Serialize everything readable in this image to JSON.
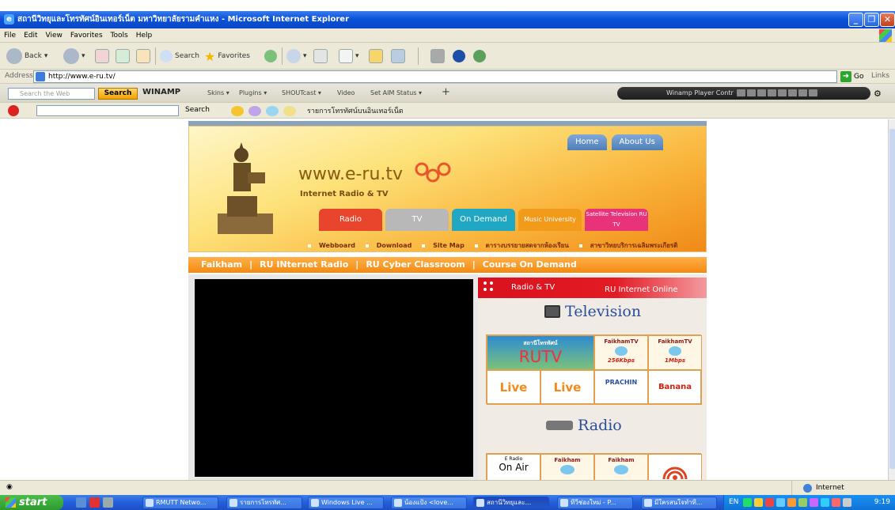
{
  "window": {
    "title": "สถานีวิทยุและโทรทัศน์อินเทอร์เน็ต มหาวิทยาลัยรามคำแหง - Microsoft Internet Explorer"
  },
  "menubar": {
    "items": [
      "File",
      "Edit",
      "View",
      "Favorites",
      "Tools",
      "Help"
    ]
  },
  "toolbar": {
    "back": "Back",
    "search": "Search",
    "favorites": "Favorites"
  },
  "address": {
    "label": "Address",
    "url": "http://www.e-ru.tv/",
    "go": "Go",
    "links": "Links"
  },
  "winamp_bar": {
    "search_placeholder": "Search the Web",
    "search_button": "Search",
    "brand": "WINAMP",
    "menus": [
      "Skins ▾",
      "Plugins ▾",
      "SHOUTcast ▾",
      "Video",
      "Set AIM Status ▾"
    ],
    "player_label": "Winamp Player Contr"
  },
  "toolbar3": {
    "search": "Search",
    "thai_link": "รายการโทรทัศน์บนอินเทอร์เน็ต"
  },
  "site": {
    "nav_top": [
      "Home",
      "About Us"
    ],
    "name": "www.e-ru.tv",
    "tagline": "Internet Radio & TV",
    "tabs": [
      {
        "label": "Radio",
        "color": "#e8452c"
      },
      {
        "label": "TV",
        "color": "#b8b8b8"
      },
      {
        "label": "On Demand",
        "color": "#1fa7c4"
      },
      {
        "label": "Music University",
        "color": "#f29a1a"
      },
      {
        "label": "Satellite Television RU TV",
        "color": "#e8337a"
      }
    ],
    "sub_links": [
      "Webboard",
      "Download",
      "Site Map",
      "ตารางบรรยายสดจากห้องเรียน",
      "สาขาวิทยบริการเฉลิมพระเกียรติ"
    ],
    "nav2": [
      "Faikham",
      "RU INternet Radio",
      "RU Cyber Classroom",
      "Course On Demand"
    ],
    "panel": {
      "header_left": "Radio & TV",
      "header_right": "RU Internet Online",
      "television": "Television",
      "radio": "Radio",
      "tv_cells": {
        "rutv_top": "สถานีโทรทัศน์",
        "rutv": "RUTV",
        "faikham1": "FaikhamTV",
        "rate1": "256Kbps",
        "faikham2": "FaikhamTV",
        "rate2": "1Mbps",
        "live1": "Live",
        "live2": "Live",
        "prachin": "PRACHIN",
        "banana": "Banana"
      },
      "radio_cells": {
        "eradio_small": "E Radio",
        "onair": "On Air",
        "faikham_a": "Faikham",
        "faikham_b": "Faikham"
      }
    }
  },
  "status": {
    "zone": "Internet"
  },
  "taskbar": {
    "start": "start",
    "tasks": [
      "RMUTT Netwo...",
      "รายการโทรทัศ...",
      "Windows Live ...",
      "น้องแป้ง <love...",
      "สถานีวิทยุและ...",
      "ทีวีช่องใหม่ - P...",
      "มีใครสนใจทำที..."
    ],
    "lang": "EN",
    "clock": "9:19"
  }
}
